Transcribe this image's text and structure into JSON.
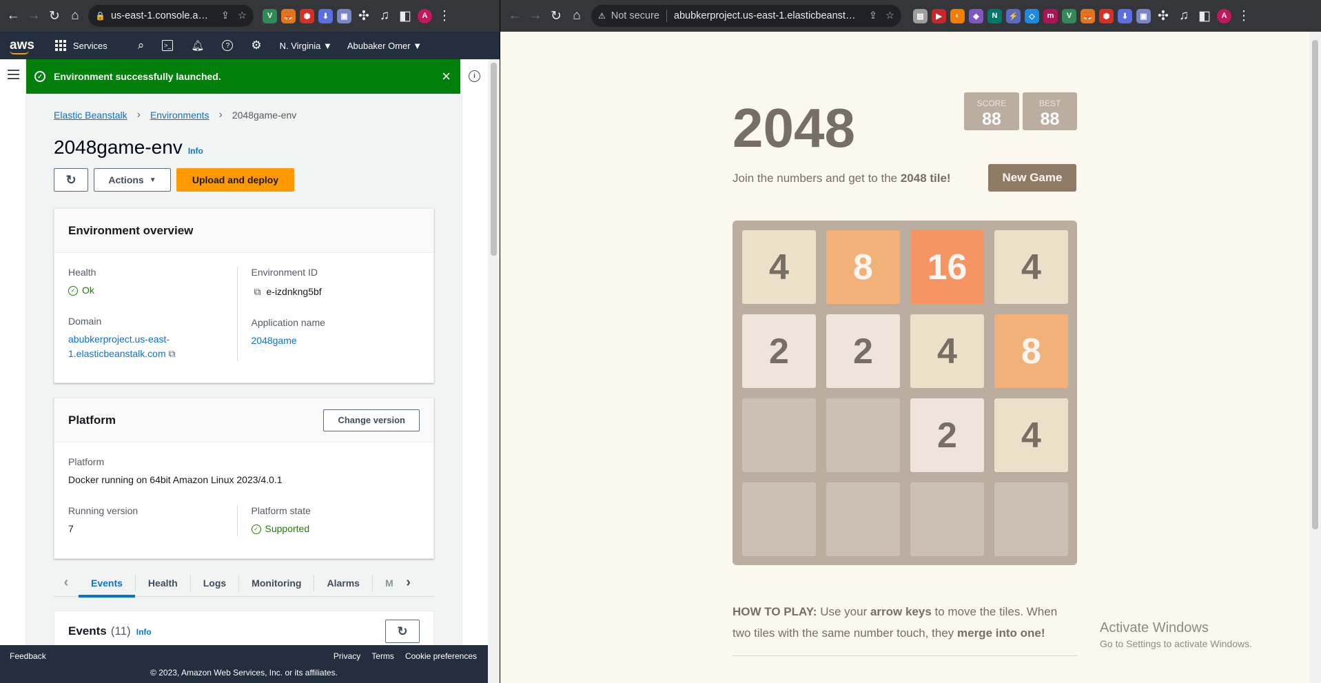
{
  "left_browser": {
    "url": "us-east-1.console.aws....",
    "extensions": [
      {
        "name": "vpn-ext",
        "color": "#2e8b57",
        "glyph": "V"
      },
      {
        "name": "metamask-ext",
        "color": "#e2761b",
        "glyph": "🦊"
      },
      {
        "name": "red-ext",
        "color": "#d93025",
        "glyph": "⬢"
      },
      {
        "name": "download-ext",
        "color": "#5b6fe0",
        "glyph": "⬇"
      },
      {
        "name": "window-ext",
        "color": "#7986cb",
        "glyph": "▣"
      }
    ]
  },
  "right_browser": {
    "security": "Not secure",
    "url": "abubkerproject.us-east-1.elasticbeanstalk....",
    "extensions": [
      {
        "name": "ext-1",
        "color": "#9e9e9e",
        "glyph": "▤"
      },
      {
        "name": "ext-2",
        "color": "#c62828",
        "glyph": "▶"
      },
      {
        "name": "ext-3",
        "color": "#f57c00",
        "glyph": "◐"
      },
      {
        "name": "ext-4",
        "color": "#7e57c2",
        "glyph": "◆"
      },
      {
        "name": "ext-5",
        "color": "#00796b",
        "glyph": "N"
      },
      {
        "name": "ext-6",
        "color": "#5c6bc0",
        "glyph": "⚡"
      },
      {
        "name": "ext-7",
        "color": "#1e88e5",
        "glyph": "◇"
      },
      {
        "name": "ext-8",
        "color": "#ad1457",
        "glyph": "m"
      },
      {
        "name": "ext-9",
        "color": "#2e8b57",
        "glyph": "V"
      },
      {
        "name": "ext-10",
        "color": "#e2761b",
        "glyph": "🦊"
      },
      {
        "name": "ext-11",
        "color": "#d93025",
        "glyph": "⬢"
      },
      {
        "name": "ext-12",
        "color": "#5b6fe0",
        "glyph": "⬇"
      },
      {
        "name": "ext-13",
        "color": "#7986cb",
        "glyph": "▣"
      }
    ]
  },
  "aws": {
    "logo": "aws",
    "services": "Services",
    "region": "N. Virginia ▼",
    "user": "Abubaker Omer ▼",
    "flash": "Environment successfully launched.",
    "breadcrumb": [
      "Elastic Beanstalk",
      "Environments",
      "2048game-env"
    ],
    "title": "2048game-env",
    "info": "Info",
    "actions": "Actions",
    "upload": "Upload and deploy",
    "overview": {
      "heading": "Environment overview",
      "health_label": "Health",
      "health_value": "Ok",
      "domain_label": "Domain",
      "domain_line1": "abubkerproject.us-east-",
      "domain_line2": "1.elasticbeanstalk.com",
      "envid_label": "Environment ID",
      "envid_value": "e-izdnkng5bf",
      "app_label": "Application name",
      "app_value": "2048game"
    },
    "platform": {
      "heading": "Platform",
      "change": "Change version",
      "platform_label": "Platform",
      "platform_value": "Docker running on 64bit Amazon Linux 2023/4.0.1",
      "running_label": "Running version",
      "running_value": "7",
      "state_label": "Platform state",
      "state_value": "Supported"
    },
    "tabs": [
      "Events",
      "Health",
      "Logs",
      "Monitoring",
      "Alarms",
      "M"
    ],
    "events_heading": "Events",
    "events_count": "(11)",
    "footer": {
      "feedback": "Feedback",
      "privacy": "Privacy",
      "terms": "Terms",
      "cookies": "Cookie preferences",
      "copyright": "© 2023, Amazon Web Services, Inc. or its affiliates."
    }
  },
  "game": {
    "title": "2048",
    "score_label": "SCORE",
    "score": "88",
    "best_label": "BEST",
    "best": "88",
    "intro_pre": "Join the numbers and get to the ",
    "intro_bold": "2048 tile!",
    "new_game": "New Game",
    "grid": [
      [
        4,
        8,
        16,
        4
      ],
      [
        2,
        2,
        4,
        8
      ],
      [
        null,
        null,
        2,
        4
      ],
      [
        null,
        null,
        null,
        null
      ]
    ],
    "how_label": "HOW TO PLAY:",
    "how_1": " Use your ",
    "how_keys": "arrow keys",
    "how_2": " to move the tiles. When two tiles with the same number touch, they ",
    "how_merge": "merge into one!"
  },
  "watermark": {
    "line1": "Activate Windows",
    "line2": "Go to Settings to activate Windows."
  },
  "tile_colors": {
    "2": "#eee4da",
    "4": "#ede0c8",
    "8": "#f2b179",
    "16": "#f59563"
  }
}
